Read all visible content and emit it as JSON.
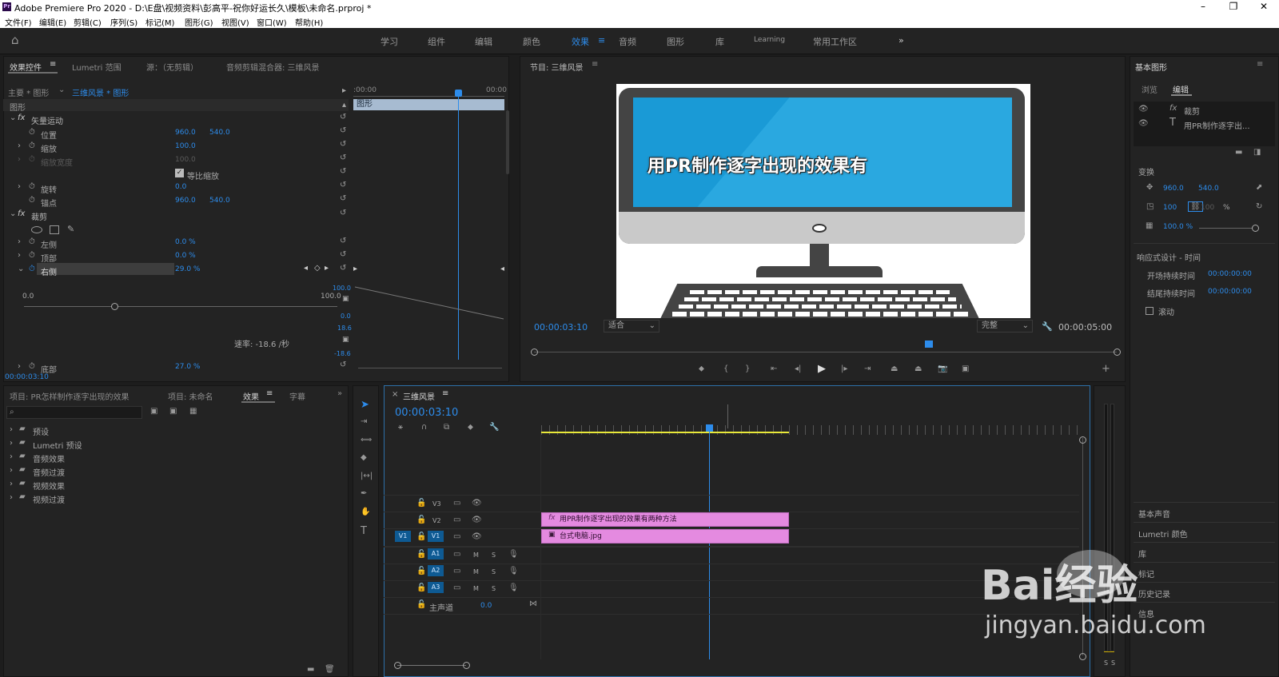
{
  "window": {
    "title": "Adobe Premiere Pro 2020 - D:\\E盘\\视频资料\\彭高平-祝你好运长久\\模板\\未命名.prproj *",
    "app_badge": "Pr"
  },
  "menu": [
    "文件(F)",
    "编辑(E)",
    "剪辑(C)",
    "序列(S)",
    "标记(M)",
    "图形(G)",
    "视图(V)",
    "窗口(W)",
    "帮助(H)"
  ],
  "workspaces": [
    "学习",
    "组件",
    "编辑",
    "颜色",
    "效果",
    "音频",
    "图形",
    "库",
    "Learning",
    "常用工作区"
  ],
  "active_workspace": "效果",
  "effect_controls": {
    "tabs": [
      "效果控件",
      "Lumetri 范围",
      "源：（无剪辑）",
      "音频剪辑混合器: 三维风景"
    ],
    "master": "主要 * 图形",
    "sequence": "三维风景 * 图形",
    "time_start": ":00:00",
    "time_end": "00:00",
    "clip_label": "图形",
    "section": "图形",
    "vector_motion": "矢量运动",
    "position_label": "位置",
    "position_x": "960.0",
    "position_y": "540.0",
    "scale_label": "缩放",
    "scale_value": "100.0",
    "scale_width_label": "缩放宽度",
    "scale_width_value": "100.0",
    "uniform_label": "等比缩放",
    "rotation_label": "旋转",
    "rotation_value": "0.0",
    "anchor_label": "锚点",
    "anchor_x": "960.0",
    "anchor_y": "540.0",
    "crop": "裁剪",
    "left_label": "左侧",
    "left_value": "0.0 %",
    "top_label": "顶部",
    "top_value": "0.0 %",
    "right_label": "右侧",
    "right_value": "29.0 %",
    "bottom_label": "底部",
    "bottom_value": "27.0 %",
    "graph_min": "0.0",
    "graph_max": "100.0",
    "graph_top": "100.0",
    "graph_zero": "0.0",
    "vel_top": "18.6",
    "vel_bottom": "-18.6",
    "velocity": "速率: -18.6 /秒",
    "current_time": "00:00:03:10"
  },
  "program": {
    "title": "节目: 三维风景",
    "overlay_text": "用PR制作逐字出现的效果有",
    "timecode": "00:00:03:10",
    "fit": "适合",
    "quality": "完整",
    "duration": "00:00:05:00"
  },
  "essential_graphics": {
    "title": "基本图形",
    "tabs": [
      "浏览",
      "编辑"
    ],
    "layers": [
      {
        "icon": "fx",
        "label": "裁剪"
      },
      {
        "icon": "T",
        "label": "用PR制作逐字出..."
      }
    ],
    "transform": "变换",
    "pos_x": "960.0",
    "pos_y": "540.0",
    "scale": "100",
    "scale2": "100",
    "pct": "%",
    "opacity": "100.0 %",
    "responsive": "响应式设计 - 时间",
    "intro_label": "开场持续时间",
    "intro_value": "00:00:00:00",
    "outro_label": "结尾持续时间",
    "outro_value": "00:00:00:00",
    "roll_label": "滚动",
    "collapsed": [
      "基本声音",
      "Lumetri 颜色",
      "库",
      "标记",
      "历史记录",
      "信息"
    ]
  },
  "project": {
    "tabs": [
      "项目: PR怎样制作逐字出现的效果",
      "项目: 未命名",
      "效果",
      "字幕"
    ],
    "search_placeholder": "",
    "items": [
      "预设",
      "Lumetri 预设",
      "音频效果",
      "音频过渡",
      "视频效果",
      "视频过渡"
    ]
  },
  "timeline": {
    "title": "三维风景",
    "timecode": "00:00:03:10",
    "video_tracks": [
      "V3",
      "V2",
      "V1"
    ],
    "audio_tracks": [
      "A1",
      "A2",
      "A3"
    ],
    "source_v": "V1",
    "master_label": "主声道",
    "master_value": "0.0",
    "clip_v2": "用PR制作逐字出现的效果有两种方法",
    "clip_v1": "台式电脑.jpg",
    "m": "M",
    "s": "S"
  },
  "meter": {
    "s1": "S",
    "s2": "S"
  },
  "watermark": {
    "brand": "Bai经验",
    "url": "jingyan.baidu.com"
  },
  "colors": {
    "accent": "#2d8ceb",
    "clip": "#e48ae0",
    "panel": "#232323"
  }
}
